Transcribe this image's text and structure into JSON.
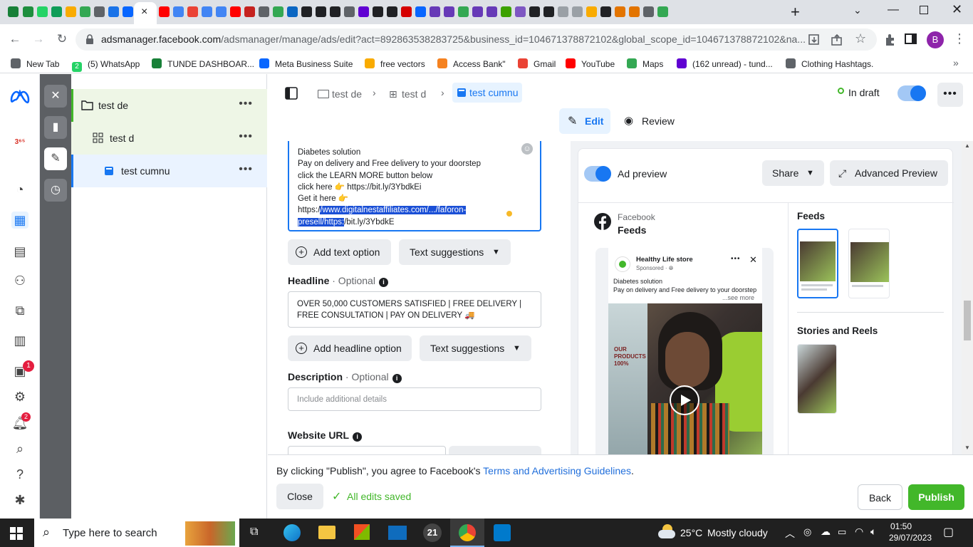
{
  "browser": {
    "active_tab_close": "×",
    "new_tab_button": "+",
    "url_domain": "adsmanager.facebook.com",
    "url_path": "/adsmanager/manage/ads/edit?act=892863538283725&business_id=104671378872102&global_scope_id=104671378872102&na...",
    "profile_initial": "B",
    "bookmarks": [
      {
        "label": "New Tab",
        "color": "#5f6368"
      },
      {
        "label": "(5) WhatsApp",
        "color": "#25d366",
        "icon_text": "2"
      },
      {
        "label": "TUNDE DASHBOAR...",
        "color": "#188038"
      },
      {
        "label": "Meta Business Suite",
        "color": "#0866ff"
      },
      {
        "label": "free vectors",
        "color": "#f9ab00"
      },
      {
        "label": "Access Bank\"",
        "color": "#f58220"
      },
      {
        "label": "Gmail",
        "color": "#ea4335"
      },
      {
        "label": "YouTube",
        "color": "#ff0000"
      },
      {
        "label": "Maps",
        "color": "#34a853"
      },
      {
        "label": "(162 unread) - tund...",
        "color": "#6001d2"
      },
      {
        "label": "Clothing Hashtags.",
        "color": "#5f6368"
      }
    ]
  },
  "left_nav": {
    "badges": {
      "campaigns": "1",
      "notifications": "2"
    }
  },
  "tree": {
    "campaign": "test de",
    "adset": "test d",
    "ad": "test cumnu",
    "more": "•••"
  },
  "topbar": {
    "crumbs": [
      "test de",
      "test d",
      "test cumnu"
    ],
    "status": "In draft",
    "tabs": {
      "edit": "Edit",
      "review": "Review"
    }
  },
  "primary_text": {
    "lines": [
      "Diabetes solution",
      "Pay on delivery and Free delivery to your doorstep",
      "click the LEARN MORE button below",
      "click here 👉 https://bit.ly/3YbdkEi",
      "Get it here 👉"
    ],
    "url_prefix": "https:/",
    "url_selected_1": "/www.digitalnestaffiliates.com/.../faforon-",
    "url_selected_2": "presell/https:",
    "url_suffix": "/bit.ly/3YbdkE"
  },
  "buttons": {
    "add_text_option": "Add text option",
    "text_suggestions": "Text suggestions",
    "add_headline_option": "Add headline option"
  },
  "headline": {
    "label": "Headline",
    "optional": "· Optional",
    "value_line1": "OVER 50,000 CUSTOMERS SATISFIED | FREE DELIVERY |",
    "value_line2": "FREE CONSULTATION | PAY ON DELIVERY 🚚"
  },
  "description": {
    "label": "Description",
    "optional": "· Optional",
    "placeholder": "Include additional details"
  },
  "website_url": {
    "label": "Website URL"
  },
  "preview": {
    "toggle_label": "Ad preview",
    "share": "Share",
    "advanced": "Advanced Preview",
    "platform": "Facebook",
    "placement": "Feeds",
    "page_name": "Healthy Life store",
    "sponsored": "Sponsored · ",
    "post_line1": "Diabetes solution",
    "post_line2": "Pay on delivery and Free delivery to your doorstep",
    "see_more": "...see more",
    "feeds_title": "Feeds",
    "stories_title": "Stories and Reels",
    "video_text": "OUR PRODUCTS 100%"
  },
  "footer": {
    "terms_prefix": "By clicking \"Publish\", you agree to Facebook's ",
    "terms_link": "Terms and Advertising Guidelines",
    "terms_suffix": ".",
    "close": "Close",
    "saved": "All edits saved",
    "back": "Back",
    "publish": "Publish"
  },
  "taskbar": {
    "search_placeholder": "Type here to search",
    "temperature": "25°C",
    "weather": "Mostly cloudy",
    "time": "01:50",
    "date": "29/07/2023",
    "clock_app": "21"
  },
  "colors": {
    "accent": "#1877f2",
    "publish": "#42b72a",
    "draft": "#42b72a",
    "selection": "#1a4fd6",
    "tree_highlight": "#eaf3ff",
    "tree_campaign": "#eef6e6"
  }
}
